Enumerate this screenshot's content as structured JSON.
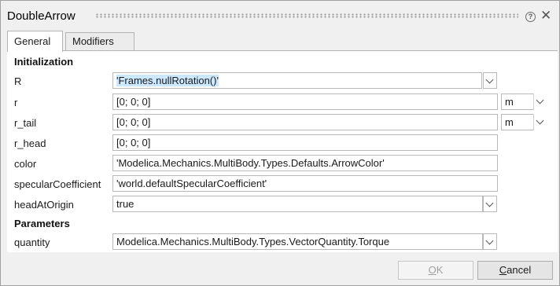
{
  "window": {
    "title": "DoubleArrow"
  },
  "tabs": [
    {
      "label": "General"
    },
    {
      "label": "Modifiers"
    }
  ],
  "sections": {
    "initialization": "Initialization",
    "parameters": "Parameters"
  },
  "fields": [
    {
      "label": "R",
      "value": "'Frames.nullRotation()'",
      "has_dropdown": true
    },
    {
      "label": "r",
      "value": "[0; 0; 0]",
      "unit": "m"
    },
    {
      "label": "r_tail",
      "value": "[0; 0; 0]",
      "unit": "m"
    },
    {
      "label": "r_head",
      "value": "[0; 0; 0]"
    },
    {
      "label": "color",
      "value": "'Modelica.Mechanics.MultiBody.Types.Defaults.ArrowColor'"
    },
    {
      "label": "specularCoefficient",
      "value": "'world.defaultSpecularCoefficient'"
    },
    {
      "label": "headAtOrigin",
      "value": "true",
      "has_dropdown": true
    },
    {
      "label": "quantity",
      "value": "Modelica.Mechanics.MultiBody.Types.VectorQuantity.Torque",
      "has_dropdown": true
    }
  ],
  "buttons": {
    "ok_first": "O",
    "ok_rest": "K",
    "cancel_first": "C",
    "cancel_rest": "ancel"
  }
}
